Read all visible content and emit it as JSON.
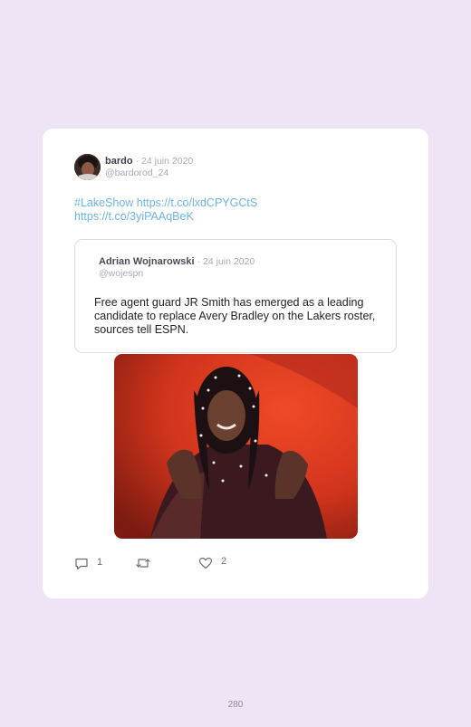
{
  "tweet": {
    "author_name": "bardo",
    "date": "· 24 juin 2020",
    "handle": "@bardorod_24",
    "text_line1": "#LakeShow https://t.co/lxdCPYGCtS",
    "text_line2": "https://t.co/3yiPAAqBeK"
  },
  "quoted": {
    "author_name": "Adrian Wojnarowski",
    "date": "· 24 juin 2020",
    "handle": "@wojespn",
    "text": "Free agent guard JR Smith has emerged as a leading candidate to replace Avery Bradley on the Lakers roster, sources tell ESPN."
  },
  "actions": {
    "reply_icon": "reply-icon",
    "reply_count": "1",
    "retweet_icon": "retweet-icon",
    "like_icon": "heart-icon",
    "like_count": "2"
  },
  "page": {
    "number": "280"
  }
}
